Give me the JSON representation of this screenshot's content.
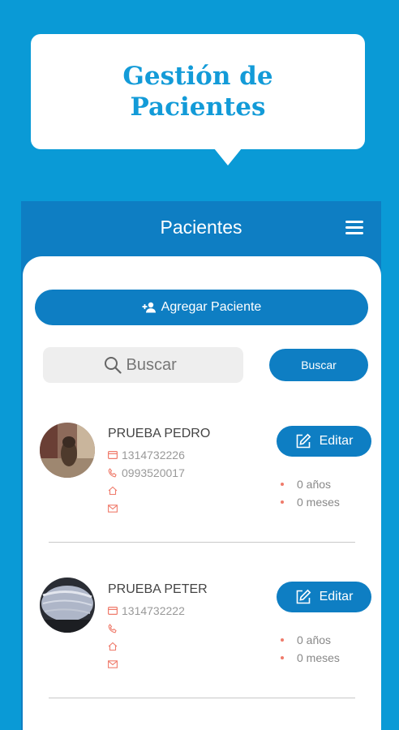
{
  "header": {
    "title": "Gestión de Pacientes"
  },
  "topbar": {
    "title": "Pacientes",
    "menu_icon": "hamburger-menu-icon"
  },
  "actions": {
    "add_patient_label": "Agregar Paciente",
    "add_patient_icon": "user-plus-icon"
  },
  "search": {
    "placeholder": "Buscar",
    "value": "",
    "button_label": "Buscar"
  },
  "patients": [
    {
      "name": "PRUEBA PEDRO",
      "id_number": "1314732226",
      "phone": "0993520017",
      "address": "",
      "email": "",
      "age_years": "0 años",
      "age_months": "0 meses",
      "edit_label": "Editar"
    },
    {
      "name": "PRUEBA PETER",
      "id_number": "1314732222",
      "phone": "",
      "address": "",
      "email": "",
      "age_years": "0 años",
      "age_months": "0 meses",
      "edit_label": "Editar"
    }
  ],
  "colors": {
    "background": "#0a9ad6",
    "primary": "#0e7ec3",
    "accent_icons": "#ef7b6b",
    "title": "#139bd8"
  }
}
